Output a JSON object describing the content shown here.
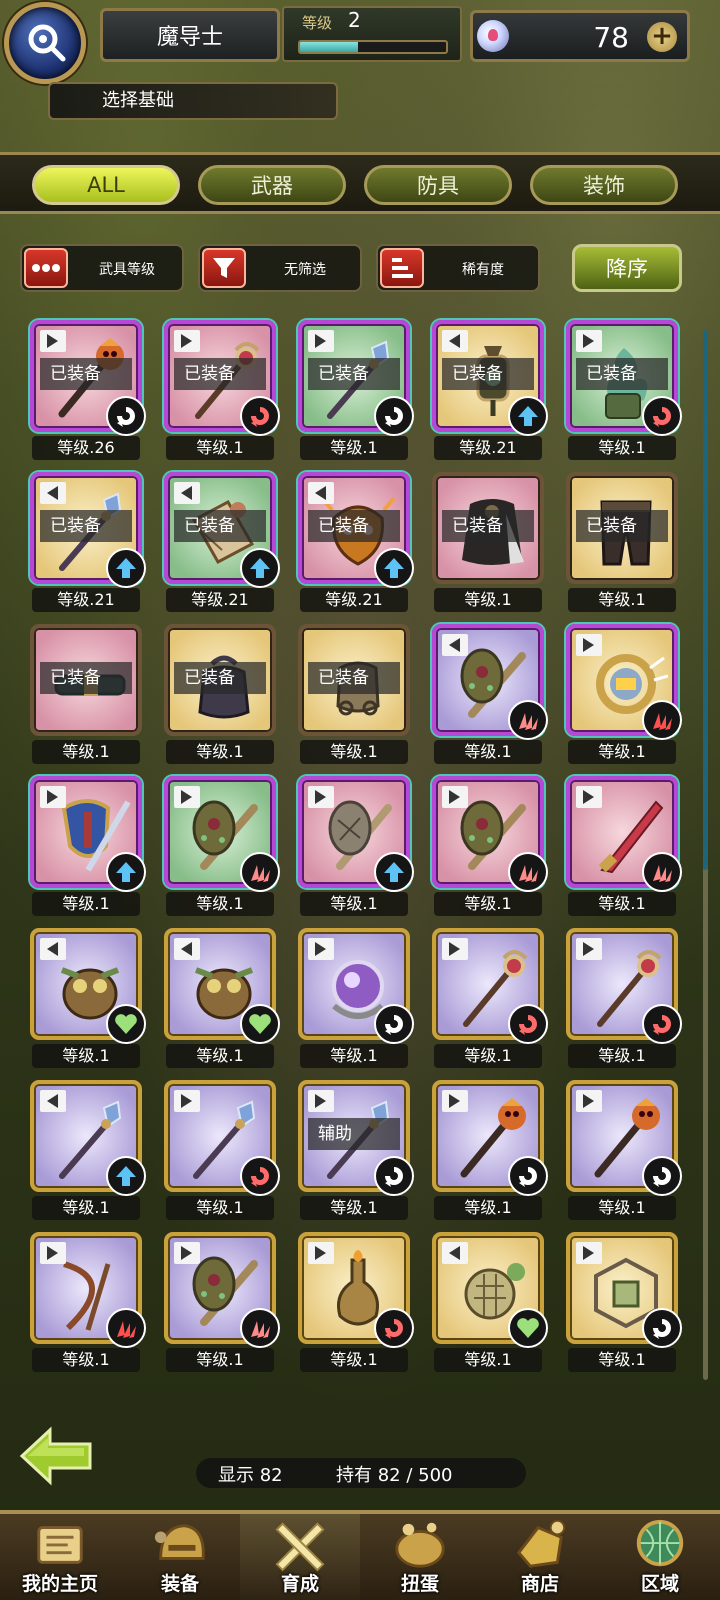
{
  "header": {
    "class_name": "魔导士",
    "level_label": "等级",
    "level_value": "2",
    "level_progress": 0.4,
    "gem_count": "78",
    "section_title": "选择基础"
  },
  "tabs": [
    {
      "label": "ALL",
      "active": true
    },
    {
      "label": "武器",
      "active": false
    },
    {
      "label": "防具",
      "active": false
    },
    {
      "label": "装饰",
      "active": false
    }
  ],
  "sort": {
    "sort_by_label": "武具等级",
    "filter_label": "无筛选",
    "rarity_label": "稀有度",
    "order_label": "降序"
  },
  "items": [
    {
      "level": "等级.26",
      "equipped": "已装备",
      "tri": "right",
      "frame": "purple",
      "bg": "pink",
      "art": "staff-skull",
      "badge": "swirl"
    },
    {
      "level": "等级.1",
      "equipped": "已装备",
      "tri": "right",
      "frame": "purple",
      "bg": "pink",
      "art": "staff-orb",
      "badge": "swirl-red"
    },
    {
      "level": "等级.1",
      "equipped": "已装备",
      "tri": "right",
      "frame": "purple",
      "bg": "green",
      "art": "staff-crystal",
      "badge": "swirl"
    },
    {
      "level": "等级.21",
      "equipped": "已装备",
      "tri": "left",
      "frame": "purple",
      "bg": "yellow",
      "art": "lantern",
      "badge": "arrow"
    },
    {
      "level": "等级.1",
      "equipped": "已装备",
      "tri": "right",
      "frame": "purple",
      "bg": "green",
      "art": "flame",
      "badge": "swirl-red"
    },
    {
      "level": "等级.21",
      "equipped": "已装备",
      "tri": "left",
      "frame": "purple",
      "bg": "yellow",
      "art": "staff-crystal",
      "badge": "arrow"
    },
    {
      "level": "等级.21",
      "equipped": "已装备",
      "tri": "left",
      "frame": "purple",
      "bg": "green",
      "art": "scroll",
      "badge": "arrow"
    },
    {
      "level": "等级.21",
      "equipped": "已装备",
      "tri": "left",
      "frame": "purple",
      "bg": "pink",
      "art": "mask",
      "badge": "arrow"
    },
    {
      "level": "等级.1",
      "equipped": "已装备",
      "tri": "none",
      "frame": "brown",
      "bg": "pink",
      "art": "cape",
      "badge": "none"
    },
    {
      "level": "等级.1",
      "equipped": "已装备",
      "tri": "none",
      "frame": "brown",
      "bg": "yellow",
      "art": "pants",
      "badge": "none"
    },
    {
      "level": "等级.1",
      "equipped": "已装备",
      "tri": "none",
      "frame": "brown",
      "bg": "pink",
      "art": "belt",
      "badge": "none"
    },
    {
      "level": "等级.1",
      "equipped": "已装备",
      "tri": "none",
      "frame": "brown",
      "bg": "yellow",
      "art": "pouch",
      "badge": "none"
    },
    {
      "level": "等级.1",
      "equipped": "已装备",
      "tri": "none",
      "frame": "brown",
      "bg": "yellow",
      "art": "bag",
      "badge": "none"
    },
    {
      "level": "等级.1",
      "equipped": "",
      "tri": "left",
      "frame": "purple",
      "bg": "lav",
      "art": "club",
      "badge": "claw"
    },
    {
      "level": "等级.1",
      "equipped": "",
      "tri": "right",
      "frame": "purple",
      "bg": "yellow",
      "art": "ring",
      "badge": "claw-red"
    },
    {
      "level": "等级.1",
      "equipped": "",
      "tri": "right",
      "frame": "purple",
      "bg": "pink",
      "art": "shield",
      "badge": "arrow"
    },
    {
      "level": "等级.1",
      "equipped": "",
      "tri": "right",
      "frame": "purple",
      "bg": "green",
      "art": "club",
      "badge": "claw"
    },
    {
      "level": "等级.1",
      "equipped": "",
      "tri": "right",
      "frame": "purple",
      "bg": "pink",
      "art": "club-stone",
      "badge": "arrow"
    },
    {
      "level": "等级.1",
      "equipped": "",
      "tri": "right",
      "frame": "purple",
      "bg": "pink",
      "art": "club",
      "badge": "claw"
    },
    {
      "level": "等级.1",
      "equipped": "",
      "tri": "right",
      "frame": "purple",
      "bg": "pink",
      "art": "blade",
      "badge": "claw"
    },
    {
      "level": "等级.1",
      "equipped": "",
      "tri": "left",
      "frame": "gold",
      "bg": "lav",
      "art": "owl",
      "badge": "heart"
    },
    {
      "level": "等级.1",
      "equipped": "",
      "tri": "left",
      "frame": "gold",
      "bg": "lav",
      "art": "owl",
      "badge": "heart"
    },
    {
      "level": "等级.1",
      "equipped": "",
      "tri": "right",
      "frame": "gold",
      "bg": "lav",
      "art": "orb",
      "badge": "swirl"
    },
    {
      "level": "等级.1",
      "equipped": "",
      "tri": "right",
      "frame": "gold",
      "bg": "lav",
      "art": "staff-orb",
      "badge": "swirl-red"
    },
    {
      "level": "等级.1",
      "equipped": "",
      "tri": "right",
      "frame": "gold",
      "bg": "lav",
      "art": "staff-orb",
      "badge": "swirl-red"
    },
    {
      "level": "等级.1",
      "equipped": "",
      "tri": "left",
      "frame": "gold",
      "bg": "lav",
      "art": "staff-crystal",
      "badge": "arrow"
    },
    {
      "level": "等级.1",
      "equipped": "",
      "tri": "right",
      "frame": "gold",
      "bg": "lav",
      "art": "staff-crystal",
      "badge": "swirl-red"
    },
    {
      "level": "等级.1",
      "equipped": "辅助",
      "tri": "right",
      "frame": "gold",
      "bg": "lav",
      "art": "staff-crystal",
      "badge": "swirl"
    },
    {
      "level": "等级.1",
      "equipped": "",
      "tri": "right",
      "frame": "gold",
      "bg": "lav",
      "art": "staff-skull",
      "badge": "swirl"
    },
    {
      "level": "等级.1",
      "equipped": "",
      "tri": "right",
      "frame": "gold",
      "bg": "lav",
      "art": "staff-skull",
      "badge": "swirl"
    },
    {
      "level": "等级.1",
      "equipped": "",
      "tri": "right",
      "frame": "gold",
      "bg": "lav",
      "art": "bow",
      "badge": "claw-red"
    },
    {
      "level": "等级.1",
      "equipped": "",
      "tri": "right",
      "frame": "gold",
      "bg": "lav",
      "art": "club",
      "badge": "claw"
    },
    {
      "level": "等级.1",
      "equipped": "",
      "tri": "right",
      "frame": "gold",
      "bg": "yellow",
      "art": "flask",
      "badge": "swirl-red"
    },
    {
      "level": "等级.1",
      "equipped": "",
      "tri": "left",
      "frame": "gold",
      "bg": "yellow",
      "art": "turtle",
      "badge": "heart"
    },
    {
      "level": "等级.1",
      "equipped": "",
      "tri": "right",
      "frame": "gold",
      "bg": "yellow",
      "art": "cube",
      "badge": "swirl"
    }
  ],
  "counts": {
    "shown": "显示 82",
    "owned": "持有 82 / 500"
  },
  "nav": [
    {
      "label": "我的主页",
      "icon": "scroll-map-icon",
      "active": false
    },
    {
      "label": "装备",
      "icon": "helmet-icon",
      "active": false
    },
    {
      "label": "育成",
      "icon": "crossed-swords-icon",
      "active": true
    },
    {
      "label": "扭蛋",
      "icon": "gacha-icon",
      "active": false
    },
    {
      "label": "商店",
      "icon": "gold-icon",
      "active": false
    },
    {
      "label": "区域",
      "icon": "globe-icon",
      "active": false
    }
  ],
  "colors": {
    "tab_active": "#d6e63f",
    "tab_inactive": "#5a6420",
    "sort_red": "#c7281c",
    "frame_purple": "#b748d6",
    "frame_gold": "#caa23b",
    "badge_arrow": "#3aa7e3",
    "badge_heart": "#8ed86b",
    "badge_claw": "#ff6b6b"
  }
}
